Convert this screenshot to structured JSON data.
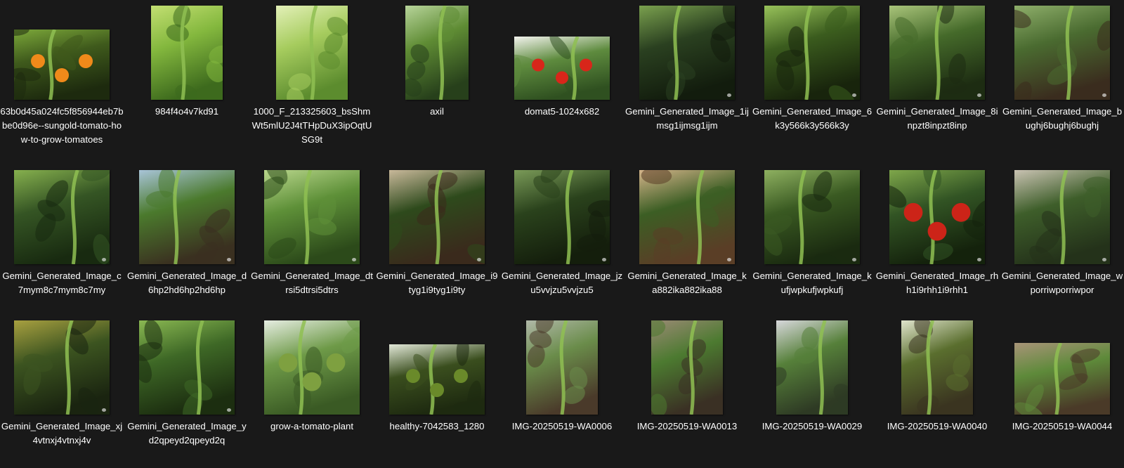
{
  "explorer": {
    "view": "large-icons",
    "files": [
      {
        "name": "63b0d45a024fc5f856944eb7bbe0d96e--sungold-tomato-how-to-grow-tomatoes",
        "icon": "image-thumbnail",
        "colors": [
          "#3f5a1c",
          "#7ca83a",
          "#1d2a0e"
        ],
        "fruit": "#f08a1a"
      },
      {
        "name": "984f4o4v7kd91",
        "icon": "image-thumbnail",
        "colors": [
          "#84b83e",
          "#c3df72",
          "#3d6a1d"
        ]
      },
      {
        "name": "1000_F_213325603_bsShmWt5mlU2J4tTHpDuX3ipOqtUSG9t",
        "icon": "image-thumbnail",
        "colors": [
          "#a6cc5e",
          "#e3f0b8",
          "#5c8c2e"
        ]
      },
      {
        "name": "axil",
        "icon": "image-thumbnail",
        "colors": [
          "#5f8c34",
          "#b7d49a",
          "#27401b"
        ]
      },
      {
        "name": "domat5-1024x682",
        "icon": "image-thumbnail",
        "colors": [
          "#5e8b3e",
          "#f3f3ee",
          "#2f5020"
        ],
        "fruit": "#d8261a"
      },
      {
        "name": "Gemini_Generated_Image_1ijmsg1ijmsg1ijm",
        "icon": "image-thumbnail",
        "colors": [
          "#2a4020",
          "#7aa04e",
          "#121c0d"
        ],
        "badge": true
      },
      {
        "name": "Gemini_Generated_Image_6k3y566k3y566k3y",
        "icon": "image-thumbnail",
        "colors": [
          "#3b5c1e",
          "#98c25a",
          "#18240c"
        ],
        "badge": true
      },
      {
        "name": "Gemini_Generated_Image_8inpzt8inpzt8inp",
        "icon": "image-thumbnail",
        "colors": [
          "#456a2a",
          "#a9c47a",
          "#1d2c12"
        ],
        "badge": true
      },
      {
        "name": "Gemini_Generated_Image_bughj6bughj6bughj",
        "icon": "image-thumbnail",
        "colors": [
          "#4a6b30",
          "#8eae6a",
          "#3a2c1e"
        ],
        "badge": true
      },
      {
        "name": "Gemini_Generated_Image_c7mym8c7mym8c7my",
        "icon": "image-thumbnail",
        "colors": [
          "#355524",
          "#86b04e",
          "#182a10"
        ],
        "badge": true
      },
      {
        "name": "Gemini_Generated_Image_d6hp2hd6hp2hd6hp",
        "icon": "image-thumbnail",
        "colors": [
          "#4b7a2d",
          "#a8c4d8",
          "#3a3020"
        ],
        "badge": true
      },
      {
        "name": "Gemini_Generated_Image_dtrsi5dtrsi5dtrs",
        "icon": "image-thumbnail",
        "colors": [
          "#5e9038",
          "#b9d68c",
          "#2c4a1a"
        ],
        "badge": true
      },
      {
        "name": "Gemini_Generated_Image_i9tyg1i9tyg1i9ty",
        "icon": "image-thumbnail",
        "colors": [
          "#2e4a1c",
          "#c8b89a",
          "#3a2a1c"
        ],
        "badge": true
      },
      {
        "name": "Gemini_Generated_Image_jzu5vvjzu5vvjzu5",
        "icon": "image-thumbnail",
        "colors": [
          "#2a421c",
          "#7a9a58",
          "#141e0c"
        ],
        "badge": true
      },
      {
        "name": "Gemini_Generated_Image_ka882ika882ika88",
        "icon": "image-thumbnail",
        "colors": [
          "#3c5e24",
          "#d4b48a",
          "#5a3e26"
        ],
        "badge": true
      },
      {
        "name": "Gemini_Generated_Image_kufjwpkufjwpkufj",
        "icon": "image-thumbnail",
        "colors": [
          "#3a5a22",
          "#8eb060",
          "#1a2a10"
        ],
        "badge": true
      },
      {
        "name": "Gemini_Generated_Image_rhh1i9rhh1i9rhh1",
        "icon": "image-thumbnail",
        "colors": [
          "#325424",
          "#7ea64a",
          "#14220c"
        ],
        "badge": true,
        "fruit": "#cc2418"
      },
      {
        "name": "Gemini_Generated_Image_wporriwporriwpor",
        "icon": "image-thumbnail",
        "colors": [
          "#3e5e2a",
          "#c9c2b2",
          "#24321a"
        ],
        "badge": true
      },
      {
        "name": "Gemini_Generated_Image_xj4vtnxj4vtnxj4v",
        "icon": "image-thumbnail",
        "colors": [
          "#3c5420",
          "#a8a040",
          "#1a2410"
        ],
        "badge": true
      },
      {
        "name": "Gemini_Generated_Image_yd2qpeyd2qpeyd2q",
        "icon": "image-thumbnail",
        "colors": [
          "#3e6826",
          "#8ab852",
          "#1c2e10"
        ],
        "badge": true
      },
      {
        "name": "grow-a-tomato-plant",
        "icon": "image-thumbnail",
        "colors": [
          "#6e9a48",
          "#e6ede2",
          "#3a5a24"
        ],
        "fruit": "#7ea040"
      },
      {
        "name": "healthy-7042583_1280",
        "icon": "image-thumbnail",
        "colors": [
          "#3a4e1e",
          "#e2e8d8",
          "#1e2a10"
        ],
        "fruit": "#6a8a2a"
      },
      {
        "name": "IMG-20250519-WA0006",
        "icon": "image-thumbnail",
        "colors": [
          "#6a8c4a",
          "#b0b8a8",
          "#4a3a2a"
        ]
      },
      {
        "name": "IMG-20250519-WA0013",
        "icon": "image-thumbnail",
        "colors": [
          "#4c7a30",
          "#9a8a74",
          "#3a3024"
        ]
      },
      {
        "name": "IMG-20250519-WA0029",
        "icon": "image-thumbnail",
        "colors": [
          "#56803a",
          "#d8d8dc",
          "#2e3a24"
        ]
      },
      {
        "name": "IMG-20250519-WA0040",
        "icon": "image-thumbnail",
        "colors": [
          "#5a6e2e",
          "#e0e4cc",
          "#3a3420"
        ]
      },
      {
        "name": "IMG-20250519-WA0044",
        "icon": "image-thumbnail",
        "colors": [
          "#5e8a3a",
          "#a89478",
          "#4a3a28"
        ]
      }
    ]
  }
}
